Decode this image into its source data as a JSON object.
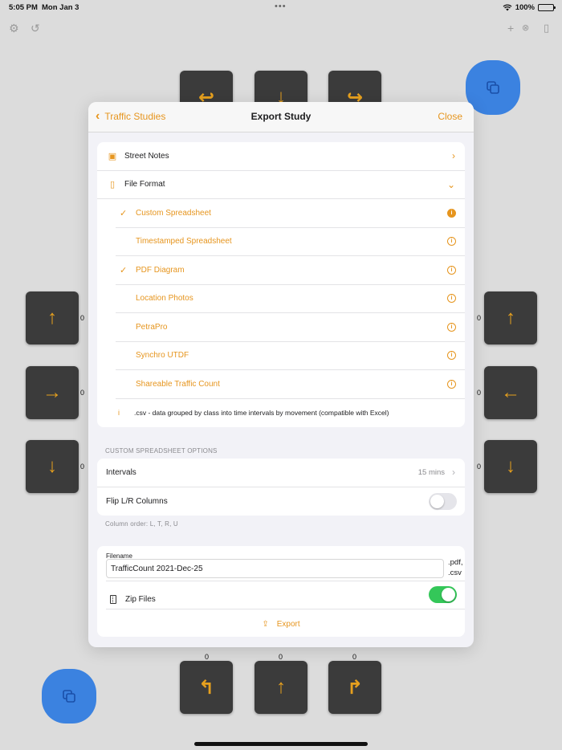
{
  "status_bar": {
    "time": "5:05 PM",
    "date": "Mon Jan 3",
    "battery": "100%",
    "multitask_dots": "•••"
  },
  "counts": {
    "left_top": "0",
    "left_mid": "0",
    "left_bottom": "0",
    "right_top": "0",
    "right_mid": "0",
    "right_bottom": "0",
    "bottom_left": "0",
    "bottom_mid": "0",
    "bottom_right": "0"
  },
  "modal": {
    "back_label": "Traffic Studies",
    "title": "Export Study",
    "close_label": "Close",
    "street_notes": "Street Notes",
    "file_format": "File Format",
    "formats": [
      {
        "label": "Custom Spreadsheet",
        "checked": true
      },
      {
        "label": "Timestamped Spreadsheet",
        "checked": false
      },
      {
        "label": "PDF Diagram",
        "checked": true
      },
      {
        "label": "Location Photos",
        "checked": false
      },
      {
        "label": "PetraPro",
        "checked": false
      },
      {
        "label": "Synchro UTDF",
        "checked": false
      },
      {
        "label": "Shareable Traffic Count",
        "checked": false
      }
    ],
    "format_note_icon": "i",
    "format_note": ".csv - data grouped by class into time intervals by movement (compatible with Excel)",
    "custom_options_header": "CUSTOM SPREADSHEET OPTIONS",
    "intervals_label": "Intervals",
    "intervals_value": "15 mins",
    "flip_label": "Flip L/R Columns",
    "flip_on": false,
    "column_order": "Column order: L, T, R, U",
    "filename_label": "Filename",
    "filename_value": "TrafficCount 2021-Dec-25",
    "ext_pdf": ".pdf,",
    "ext_csv": ".csv",
    "zip_label": "Zip Files",
    "zip_on": true,
    "export_label": "Export"
  },
  "colors": {
    "accent": "#e6951e",
    "fab": "#3b82e0",
    "tile": "#3b3b3b",
    "toggle_on": "#34c759"
  }
}
